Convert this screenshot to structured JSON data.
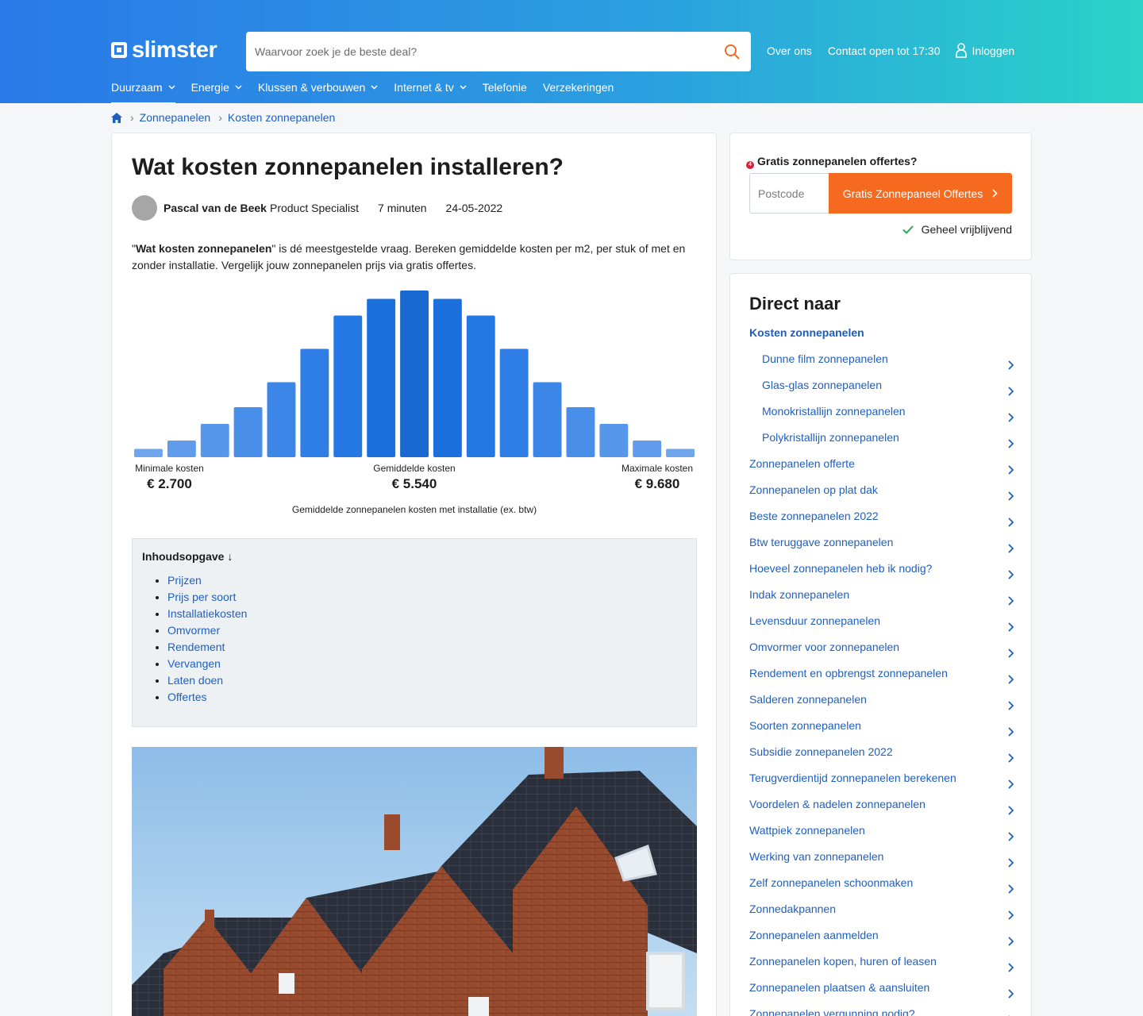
{
  "brand": {
    "name": "slimster",
    "accent": "#2a79e8",
    "cta_color": "#f56a1f",
    "link_color": "#1f5fbf"
  },
  "search": {
    "placeholder": "Waarvoor zoek je de beste deal?"
  },
  "top_links": {
    "about": "Over ons",
    "contact": "Contact open tot 17:30",
    "login": "Inloggen"
  },
  "nav": [
    {
      "label": "Duurzaam",
      "dropdown": true,
      "active": true
    },
    {
      "label": "Energie",
      "dropdown": true
    },
    {
      "label": "Klussen & verbouwen",
      "dropdown": true
    },
    {
      "label": "Internet & tv",
      "dropdown": true
    },
    {
      "label": "Telefonie",
      "dropdown": false
    },
    {
      "label": "Verzekeringen",
      "dropdown": false
    }
  ],
  "breadcrumb": [
    "Zonnepanelen",
    "Kosten zonnepanelen"
  ],
  "article": {
    "title": "Wat kosten zonnepanelen installeren?",
    "author": "Pascal van de Beek",
    "role": "Product Specialist",
    "read_time": "7 minuten",
    "date": "24-05-2022",
    "intro_quote_open": "\"",
    "intro_bold": "Wat kosten zonnepanelen",
    "intro_rest": "\" is dé meestgestelde vraag. Bereken gemiddelde kosten per m2, per stuk of met en zonder installatie. Vergelijk jouw zonnepanelen prijs via gratis offertes."
  },
  "chart_data": {
    "type": "bar",
    "values": [
      1,
      2,
      4,
      6,
      9,
      13,
      17,
      19,
      20,
      19,
      17,
      13,
      9,
      6,
      4,
      2,
      1
    ],
    "highlight_index": 8,
    "labels": [
      {
        "label": "Minimale kosten",
        "value": "€ 2.700"
      },
      {
        "label": "Gemiddelde kosten",
        "value": "€ 5.540"
      },
      {
        "label": "Maximale kosten",
        "value": "€ 9.680"
      }
    ],
    "caption": "Gemiddelde zonnepanelen kosten met installatie (ex. btw)"
  },
  "toc": {
    "title": "Inhoudsopgave ↓",
    "items": [
      "Prijzen",
      "Prijs per soort",
      "Installatiekosten",
      "Omvormer",
      "Rendement",
      "Vervangen",
      "Laten doen",
      "Offertes"
    ]
  },
  "quote": {
    "badge": "4",
    "title": "Gratis zonnepanelen offertes?",
    "postcode_placeholder": "Postcode",
    "button": "Gratis Zonnepaneel Offertes",
    "note": "Geheel vrijblijvend"
  },
  "direct": {
    "title": "Direct naar",
    "items": [
      {
        "label": "Kosten zonnepanelen",
        "current": true
      },
      {
        "label": "Dunne film zonnepanelen",
        "sub": true
      },
      {
        "label": "Glas-glas zonnepanelen",
        "sub": true
      },
      {
        "label": "Monokristallijn zonnepanelen",
        "sub": true
      },
      {
        "label": "Polykristallijn zonnepanelen",
        "sub": true
      },
      {
        "label": "Zonnepanelen offerte"
      },
      {
        "label": "Zonnepanelen op plat dak"
      },
      {
        "label": "Beste zonnepanelen 2022"
      },
      {
        "label": "Btw teruggave zonnepanelen"
      },
      {
        "label": "Hoeveel zonnepanelen heb ik nodig?"
      },
      {
        "label": "Indak zonnepanelen"
      },
      {
        "label": "Levensduur zonnepanelen"
      },
      {
        "label": "Omvormer voor zonnepanelen"
      },
      {
        "label": "Rendement en opbrengst zonnepanelen"
      },
      {
        "label": "Salderen zonnepanelen"
      },
      {
        "label": "Soorten zonnepanelen"
      },
      {
        "label": "Subsidie zonnepanelen 2022"
      },
      {
        "label": "Terugverdientijd zonnepanelen berekenen"
      },
      {
        "label": "Voordelen & nadelen zonnepanelen"
      },
      {
        "label": "Wattpiek zonnepanelen"
      },
      {
        "label": "Werking van zonnepanelen"
      },
      {
        "label": "Zelf zonnepanelen schoonmaken"
      },
      {
        "label": "Zonnedakpannen"
      },
      {
        "label": "Zonnepanelen aanmelden"
      },
      {
        "label": "Zonnepanelen kopen, huren of leasen"
      },
      {
        "label": "Zonnepanelen plaatsen & aansluiten"
      },
      {
        "label": "Zonnepanelen vergunning nodig?"
      }
    ]
  }
}
